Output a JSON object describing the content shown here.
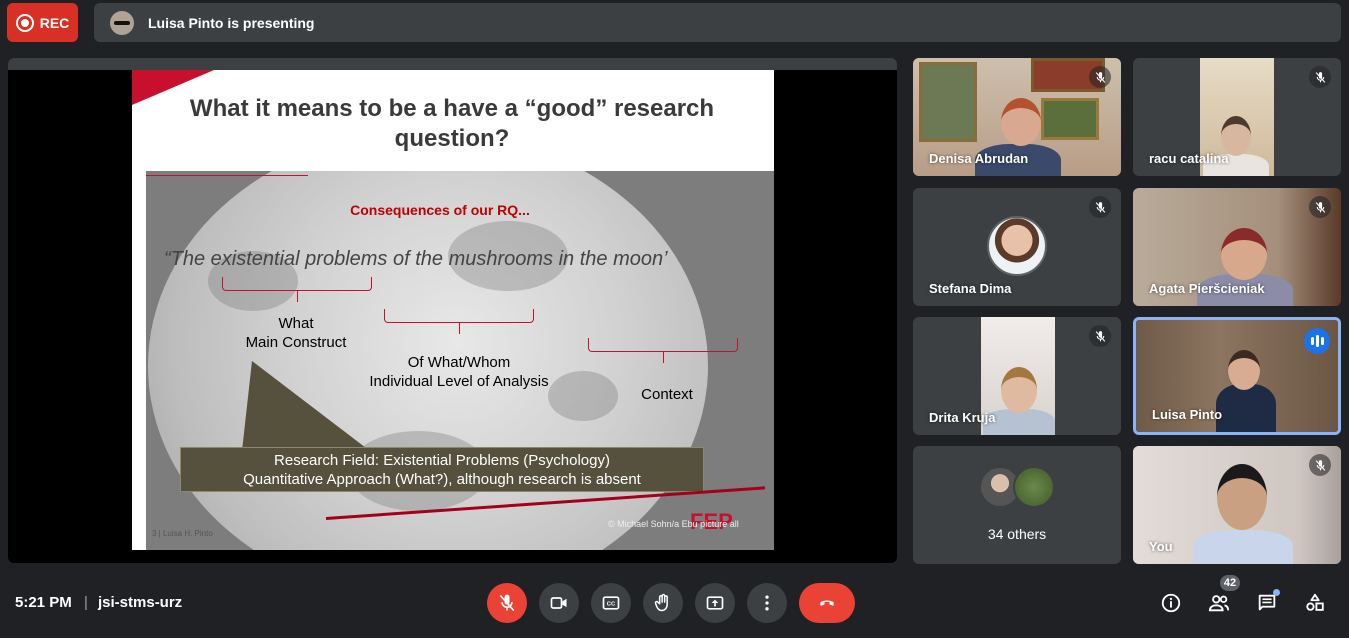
{
  "top_bar": {
    "rec_label": "REC",
    "presenting_text": "Luisa Pinto is presenting"
  },
  "slide": {
    "title": "What it means to be a have a “good” research question?",
    "consequences": "Consequences of our RQ...",
    "quote": "“The existential problems of the mushrooms in the moon’",
    "label_what_1": "What",
    "label_what_2": "Main Construct",
    "label_whom_1": "Of What/Whom",
    "label_whom_2": "Individual Level of Analysis",
    "label_context": "Context",
    "box_line1": "Research Field: Existential Problems (Psychology)",
    "box_line2": "Quantitative Approach (What?), although research is absent",
    "footer": "3 | Luisa H. Pinto",
    "copyright": "© Michael Sohn/a Ebu picture all",
    "brand": "FEP"
  },
  "participants": [
    {
      "name": "Denisa Abrudan",
      "muted": true
    },
    {
      "name": "racu catalina",
      "muted": true
    },
    {
      "name": "Stefana Dima",
      "muted": true
    },
    {
      "name": "Agata Pieršcieniak",
      "muted": true
    },
    {
      "name": "Drita Kruja",
      "muted": true
    },
    {
      "name": "Luisa Pinto",
      "muted": false,
      "speaking": true
    },
    {
      "name": "34 others"
    },
    {
      "name": "You",
      "muted": true
    }
  ],
  "bottom_bar": {
    "time": "5:21 PM",
    "separator": "|",
    "meeting_code": "jsi-stms-urz",
    "people_count": "42"
  },
  "icons": [
    "record-icon",
    "mic-off-icon",
    "camera-icon",
    "captions-icon",
    "raise-hand-icon",
    "present-icon",
    "more-options-icon",
    "hang-up-icon",
    "info-icon",
    "people-icon",
    "chat-icon",
    "activities-icon"
  ],
  "colors": {
    "accent_red": "#ea4335",
    "speaking_blue": "#1a73e8",
    "background": "#202124"
  }
}
